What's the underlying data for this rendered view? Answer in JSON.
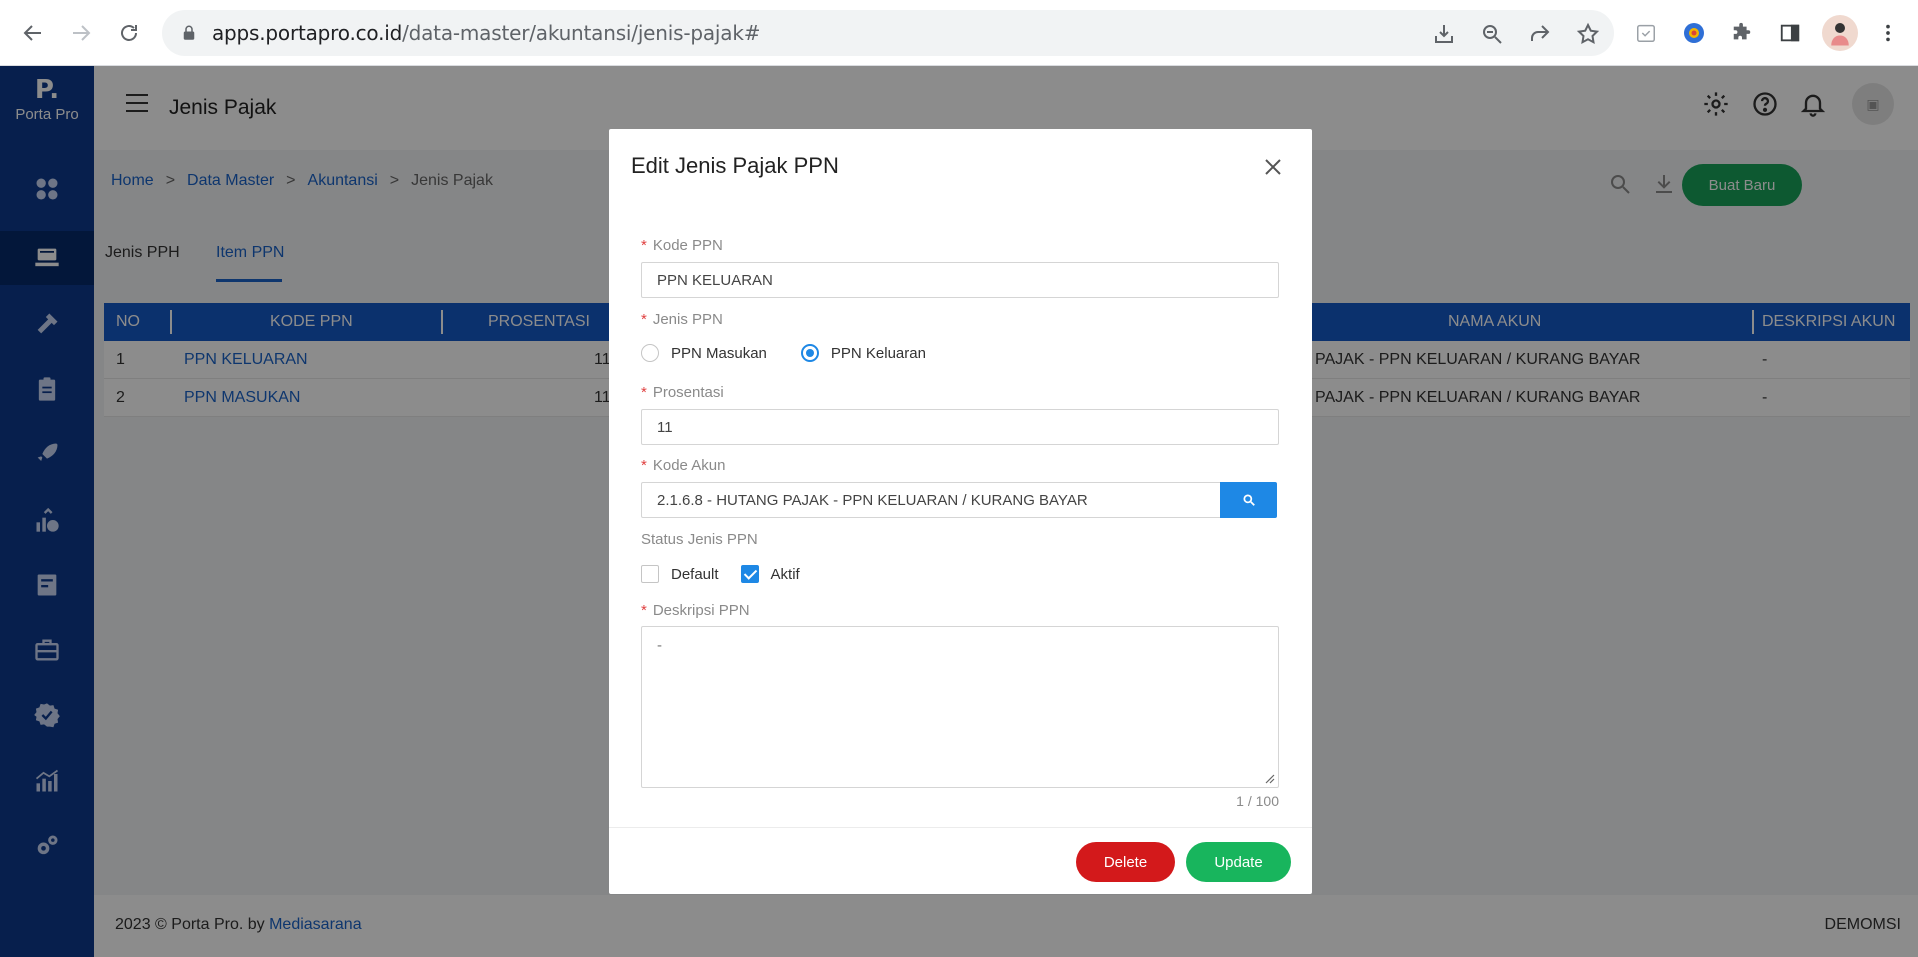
{
  "browser": {
    "url_host": "apps.portapro.co.id",
    "url_path": "/data-master/akuntansi/jenis-pajak#"
  },
  "app": {
    "logo_mark": "P.",
    "logo_name": "Porta Pro",
    "page_title": "Jenis Pajak",
    "avatar_text": "▣",
    "sidebar_items": [
      "dashboard-icon",
      "data-master-icon",
      "tools-icon",
      "clipboard-icon",
      "rocket-icon",
      "finance-icon",
      "invoice-icon",
      "briefcase-icon",
      "badge-check-icon",
      "chart-icon",
      "settings-gears-icon"
    ]
  },
  "breadcrumb": {
    "home": "Home",
    "sep": ">",
    "data_master": "Data Master",
    "akuntansi": "Akuntansi",
    "current": "Jenis Pajak"
  },
  "toolbar": {
    "new_button": "Buat Baru"
  },
  "tabs": [
    {
      "label": "Jenis PPH"
    },
    {
      "label": "Item PPN"
    }
  ],
  "table": {
    "headers": {
      "no": "NO",
      "kode": "KODE PPN",
      "prosentasi": "PROSENTASI",
      "nama_akun": "NAMA AKUN",
      "deskripsi_akun": "DESKRIPSI AKUN"
    },
    "rows": [
      {
        "no": "1",
        "kode": "PPN KELUARAN",
        "prosentasi": "11",
        "nama_akun": "PAJAK - PPN KELUARAN / KURANG BAYAR",
        "deskripsi_akun": "-"
      },
      {
        "no": "2",
        "kode": "PPN MASUKAN",
        "prosentasi": "11",
        "nama_akun": "PAJAK - PPN KELUARAN / KURANG BAYAR",
        "deskripsi_akun": "-"
      }
    ]
  },
  "footer": {
    "copyright": "2023 © Porta Pro. by ",
    "company": "Mediasarana",
    "right": "DEMOMSI"
  },
  "modal": {
    "title": "Edit Jenis Pajak PPN",
    "required_mark": "*",
    "kode_label": "Kode PPN",
    "kode_value": "PPN KELUARAN",
    "jenis_label": "Jenis PPN",
    "radio_masukan": "PPN Masukan",
    "radio_keluaran": "PPN Keluaran",
    "selected_jenis": "PPN Keluaran",
    "prosentasi_label": "Prosentasi",
    "prosentasi_value": "11",
    "kode_akun_label": "Kode Akun",
    "kode_akun_value": "2.1.6.8 - HUTANG PAJAK - PPN KELUARAN / KURANG BAYAR",
    "status_label": "Status Jenis PPN",
    "check_default": "Default",
    "check_default_checked": false,
    "check_aktif": "Aktif",
    "check_aktif_checked": true,
    "deskripsi_label": "Deskripsi PPN",
    "deskripsi_value": "-",
    "counter": "1 / 100",
    "delete_button": "Delete",
    "update_button": "Update"
  },
  "colors": {
    "sidebar": "#0e3a8c",
    "primary": "#1e88e5",
    "table_header": "#1559c7",
    "success": "#18b55d",
    "danger": "#d3191b"
  }
}
